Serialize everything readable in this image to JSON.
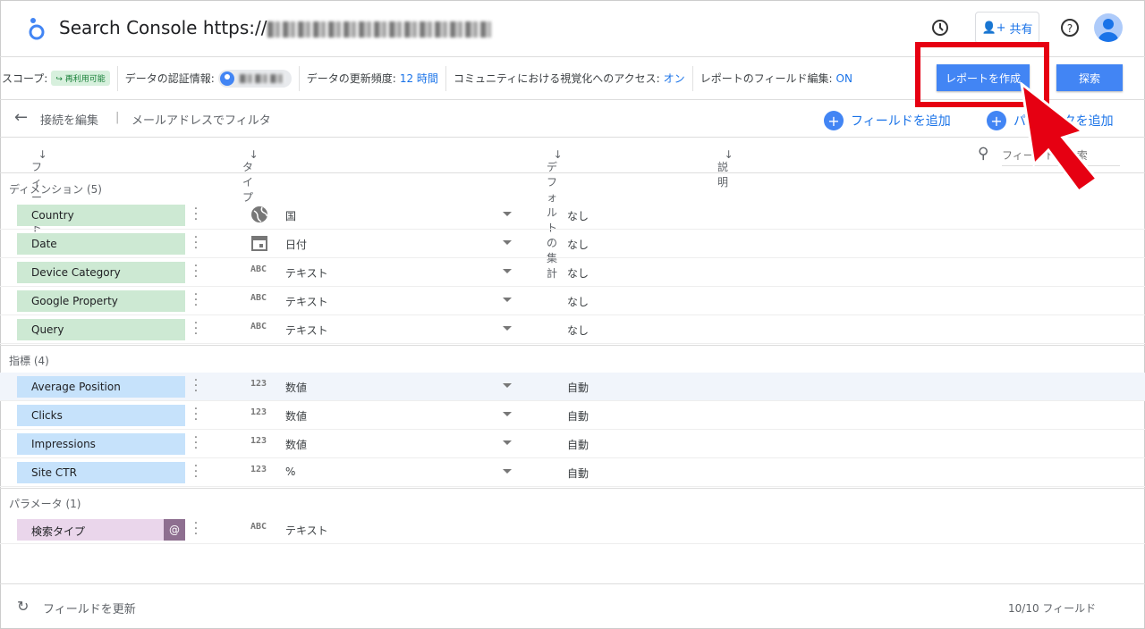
{
  "header": {
    "title": "Search Console https://",
    "history_icon": "history-icon",
    "share_label": "共有",
    "help_icon": "help-icon"
  },
  "toolbar": {
    "scope_label": "スコープ:",
    "scope_chip": "再利用可能",
    "cred_label": "データの認証情報:",
    "freshness_label": "データの更新頻度:",
    "freshness_value": "12 時間",
    "community_label": "コミュニティにおける視覚化へのアクセス:",
    "community_value": "オン",
    "field_edit_label": "レポートのフィールド編集:",
    "field_edit_value": "ON",
    "create_report": "レポートを作成",
    "explore": "探索"
  },
  "subbar": {
    "edit_connection": "接続を編集",
    "filter_by_email": "メールアドレスでフィルタ",
    "add_field": "フィールドを追加",
    "add_parameter": "パラメータを追加"
  },
  "columns": {
    "field": "フィールド",
    "type": "タイプ",
    "aggregation": "デフォルトの集計",
    "description": "説明",
    "search_placeholder": "フィールドを検索"
  },
  "sections": {
    "dimensions": {
      "label": "ディメンション (5)",
      "rows": [
        {
          "name": "Country",
          "icon": "globe-icon",
          "type": "国",
          "agg": "なし"
        },
        {
          "name": "Date",
          "icon": "calendar-icon",
          "type": "日付",
          "agg": "なし"
        },
        {
          "name": "Device Category",
          "icon": "ABC",
          "type": "テキスト",
          "agg": "なし"
        },
        {
          "name": "Google Property",
          "icon": "ABC",
          "type": "テキスト",
          "agg": "なし"
        },
        {
          "name": "Query",
          "icon": "ABC",
          "type": "テキスト",
          "agg": "なし"
        }
      ]
    },
    "metrics": {
      "label": "指標 (4)",
      "rows": [
        {
          "name": "Average Position",
          "icon": "123",
          "type": "数値",
          "agg": "自動"
        },
        {
          "name": "Clicks",
          "icon": "123",
          "type": "数値",
          "agg": "自動"
        },
        {
          "name": "Impressions",
          "icon": "123",
          "type": "数値",
          "agg": "自動"
        },
        {
          "name": "Site CTR",
          "icon": "123",
          "type": "%",
          "agg": "自動"
        }
      ]
    },
    "parameters": {
      "label": "パラメータ (1)",
      "rows": [
        {
          "name": "検索タイプ",
          "badge": "@",
          "icon": "ABC",
          "type": "テキスト"
        }
      ]
    }
  },
  "footer": {
    "refresh": "フィールドを更新",
    "count": "10/10 フィールド"
  },
  "colors": {
    "accent": "#4285f4",
    "annotation": "#e60012",
    "dimension": "#cde9d3",
    "metric": "#c6e2fb",
    "parameter": "#ead6eb"
  }
}
